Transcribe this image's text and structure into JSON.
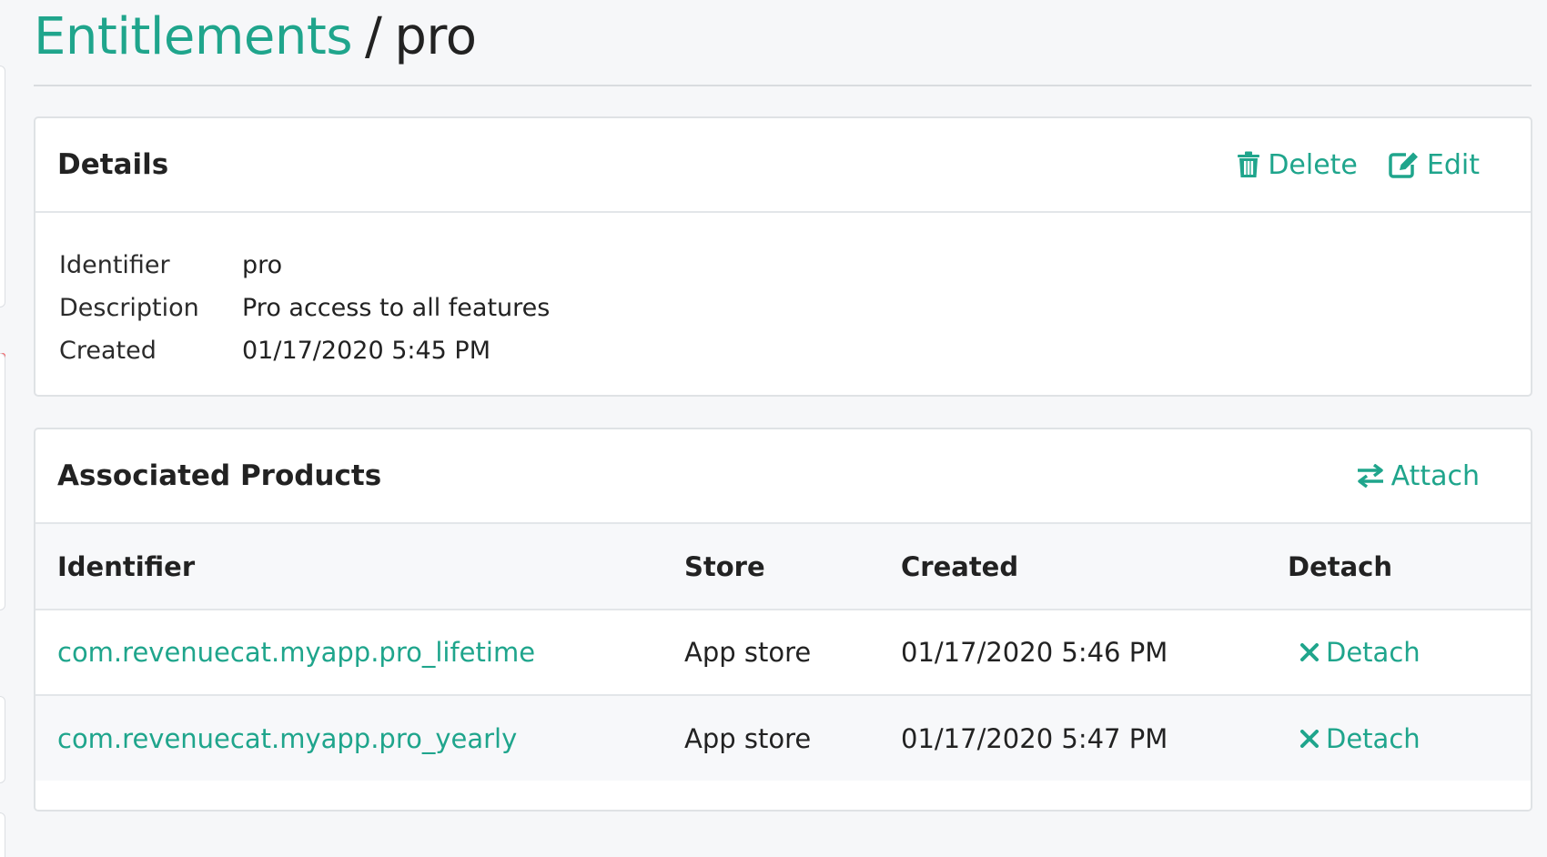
{
  "breadcrumb": {
    "parent": "Entitlements",
    "separator": "/",
    "current": "pro"
  },
  "details": {
    "title": "Details",
    "actions": {
      "delete": "Delete",
      "edit": "Edit"
    },
    "rows": [
      {
        "label": "Identifier",
        "value": "pro"
      },
      {
        "label": "Description",
        "value": "Pro access to all features"
      },
      {
        "label": "Created",
        "value": "01/17/2020 5:45 PM"
      }
    ]
  },
  "products": {
    "title": "Associated Products",
    "attach_label": "Attach",
    "columns": [
      "Identifier",
      "Store",
      "Created",
      "Detach"
    ],
    "rows": [
      {
        "identifier": "com.revenuecat.myapp.pro_lifetime",
        "store": "App store",
        "created": "01/17/2020 5:46 PM",
        "detach": "Detach"
      },
      {
        "identifier": "com.revenuecat.myapp.pro_yearly",
        "store": "App store",
        "created": "01/17/2020 5:47 PM",
        "detach": "Detach"
      }
    ]
  },
  "colors": {
    "accent": "#1fa58c",
    "sidebar_accent": "#f26065",
    "background": "#f6f7f9"
  },
  "icons": {
    "delete": "trash-icon",
    "edit": "edit-icon",
    "attach": "arrows-exchange-icon",
    "detach": "close-x-icon"
  }
}
